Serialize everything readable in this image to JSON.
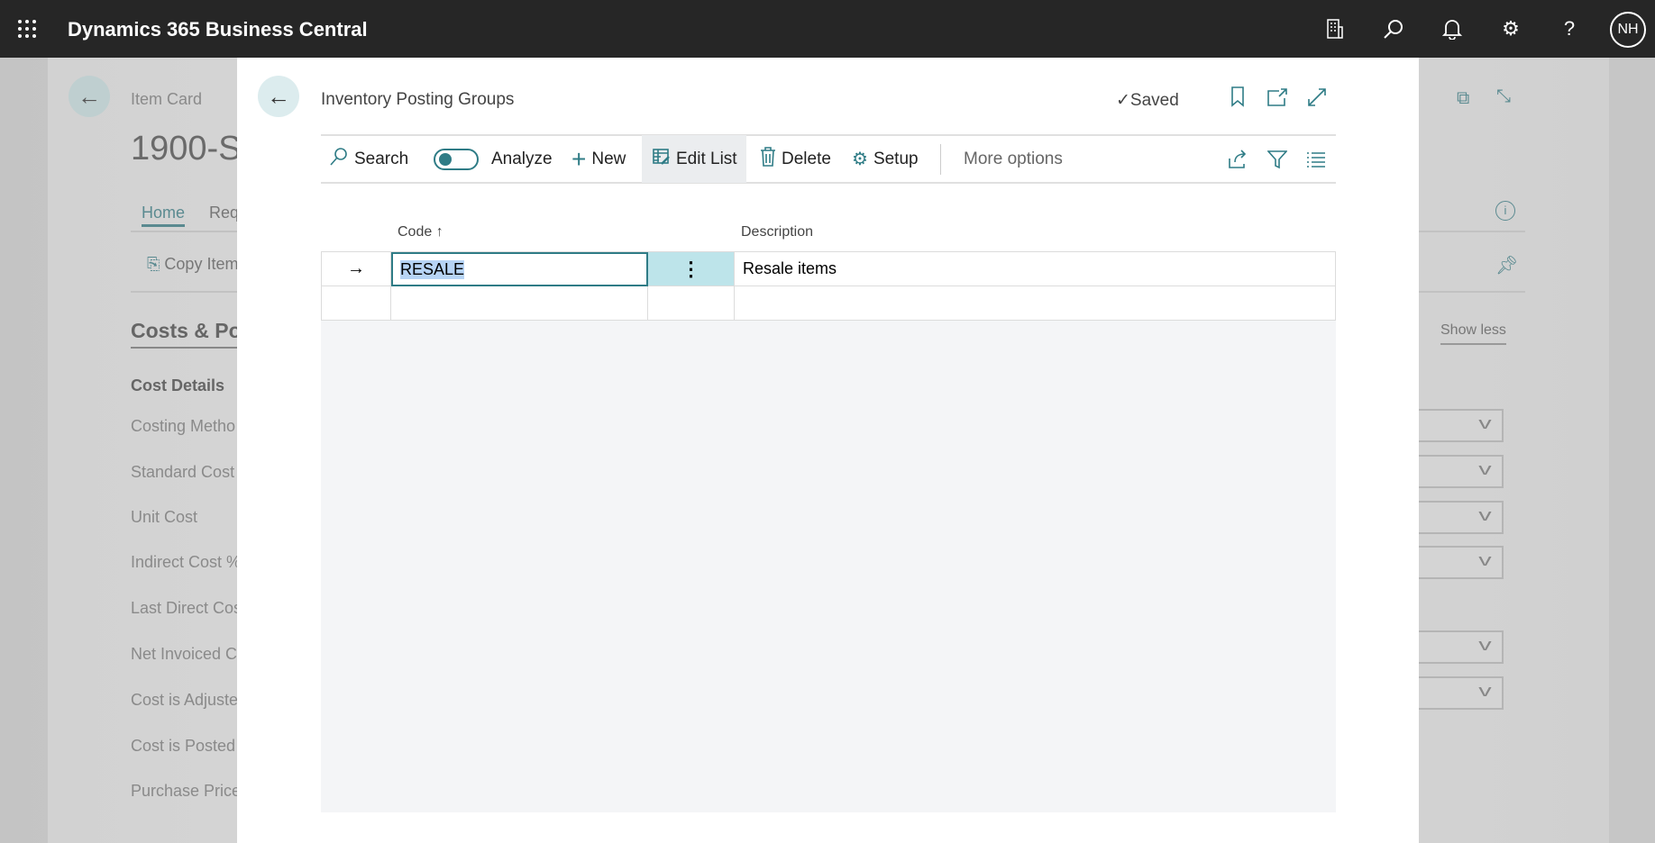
{
  "topbar": {
    "app_title": "Dynamics 365 Business Central",
    "user_initials": "NH",
    "icons": [
      "waffle-icon",
      "company-icon",
      "search-icon",
      "bell-icon",
      "gear-icon",
      "help-icon"
    ]
  },
  "background_page": {
    "breadcrumb": "Item Card",
    "title": "1900-S",
    "tabs": [
      "Home",
      "Req"
    ],
    "action": "Copy Item",
    "section_title": "Costs & Po",
    "group_title": "Cost Details",
    "fields": [
      "Costing Metho",
      "Standard Cost",
      "Unit Cost",
      "Indirect Cost %",
      "Last Direct Cos",
      "Net Invoiced C",
      "Cost is Adjuste",
      "Cost is Posted",
      "Purchase Price"
    ],
    "show_less": "Show less"
  },
  "dialog": {
    "title": "Inventory Posting Groups",
    "saved": "Saved",
    "toolbar": {
      "search": "Search",
      "analyze": "Analyze",
      "analyze_on": false,
      "new": "New",
      "edit_list": "Edit List",
      "delete": "Delete",
      "setup": "Setup",
      "more_options": "More options"
    },
    "columns": {
      "code": "Code",
      "code_sort": "↑",
      "description": "Description"
    },
    "rows": [
      {
        "code": "RESALE",
        "description": "Resale items"
      }
    ],
    "accent": "#2f7c86"
  }
}
